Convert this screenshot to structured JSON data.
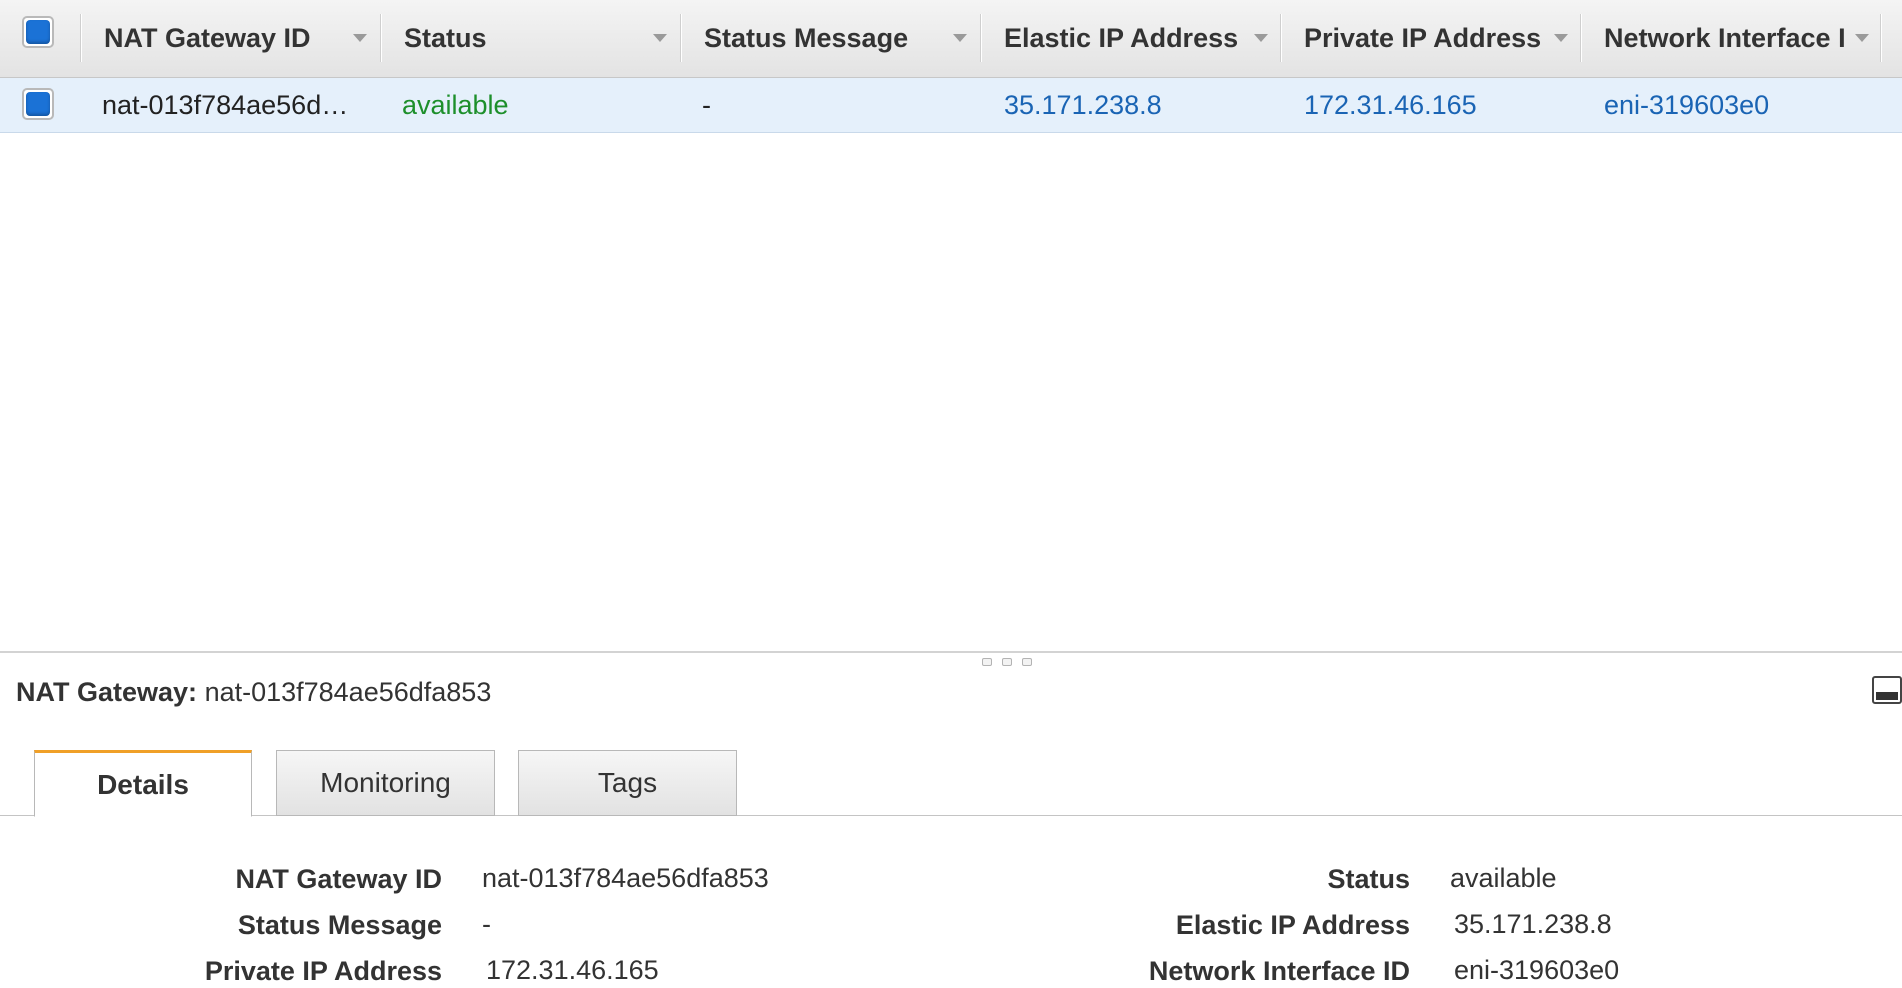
{
  "grid": {
    "columns": [
      {
        "label": "NAT Gateway ID"
      },
      {
        "label": "Status"
      },
      {
        "label": "Status Message"
      },
      {
        "label": "Elastic IP Address"
      },
      {
        "label": "Private IP Address"
      },
      {
        "label": "Network Interface I"
      }
    ],
    "row": {
      "nat_gateway_id": "nat-013f784ae56d…",
      "status": "available",
      "status_message": "-",
      "elastic_ip": "35.171.238.8",
      "private_ip": "172.31.46.165",
      "network_interface": "eni-319603e0"
    }
  },
  "details": {
    "title_label": "NAT Gateway:",
    "title_value": "nat-013f784ae56dfa853",
    "tabs": [
      {
        "label": "Details",
        "active": true
      },
      {
        "label": "Monitoring",
        "active": false
      },
      {
        "label": "Tags",
        "active": false
      }
    ],
    "left": [
      {
        "label": "NAT Gateway ID",
        "value": "nat-013f784ae56dfa853"
      },
      {
        "label": "Status Message",
        "value": "-"
      },
      {
        "label": "Private IP Address",
        "value": "172.31.46.165"
      }
    ],
    "right": [
      {
        "label": "Status",
        "value": "available"
      },
      {
        "label": "Elastic IP Address",
        "value": "35.171.238.8"
      },
      {
        "label": "Network Interface ID",
        "value": "eni-319603e0"
      }
    ]
  },
  "colors": {
    "link": "#1a64b4",
    "status_green": "#1d8f2b",
    "selected_row": "#e5f0fb",
    "active_tab_accent": "#f0a028",
    "checkbox_blue": "#1b72d6"
  }
}
